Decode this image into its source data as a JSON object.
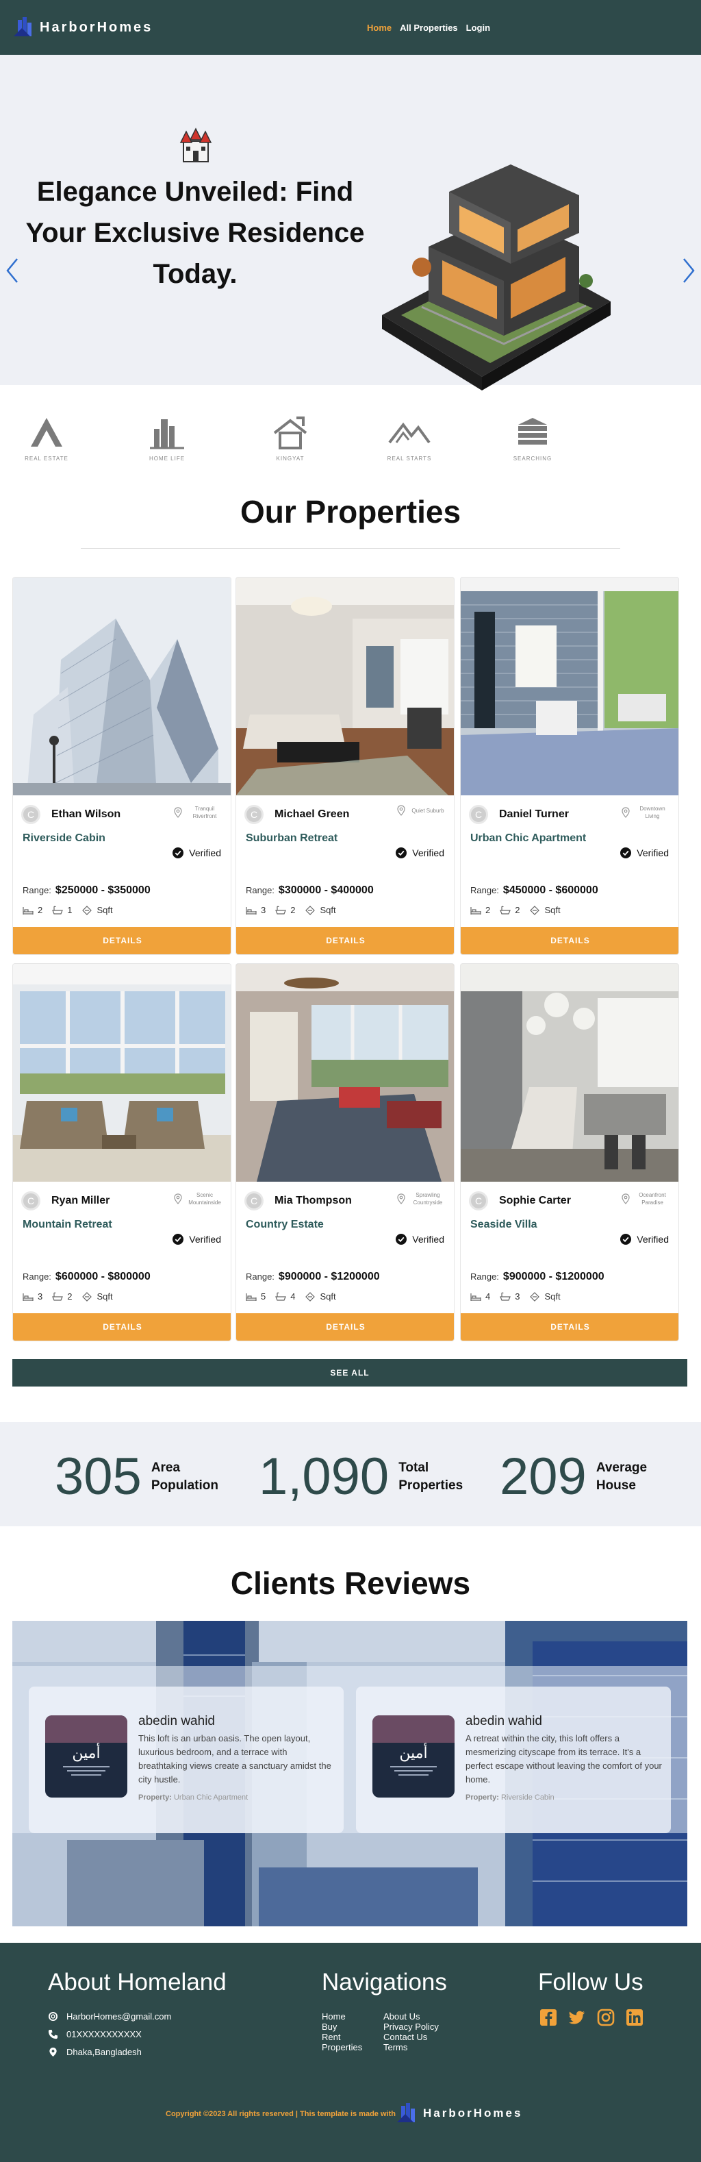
{
  "navbar": {
    "brand": "HarborHomes",
    "links": [
      {
        "label": "Home",
        "active": true
      },
      {
        "label": "All Properties",
        "active": false
      },
      {
        "label": "Login",
        "active": false
      }
    ]
  },
  "hero": {
    "title": "Elegance Unveiled: Find Your Exclusive Residence Today."
  },
  "partners": [
    {
      "label": "REAL ESTATE",
      "icon": "triangle-logo-icon"
    },
    {
      "label": "HOME LIFE",
      "icon": "city-logo-icon"
    },
    {
      "label": "KINGYAT",
      "icon": "house-logo-icon"
    },
    {
      "label": "REAL STARTS",
      "icon": "mountain-logo-icon"
    },
    {
      "label": "SEARCHING",
      "icon": "stack-logo-icon"
    }
  ],
  "properties_section": {
    "title": "Our Properties",
    "range_label": "Range:",
    "details_label": "DETAILS",
    "verified_label": "Verified",
    "sqft_label": "Sqft",
    "see_all_label": "SEE ALL"
  },
  "properties": [
    {
      "agent": "Ethan Wilson",
      "initial": "C",
      "location": "Tranquil Riverfront",
      "title": "Riverside Cabin",
      "range": "$250000 - $350000",
      "beds": "2",
      "baths": "1",
      "photo": "glass-tower"
    },
    {
      "agent": "Michael Green",
      "initial": "C",
      "location": "Quiet Suburb",
      "title": "Suburban Retreat",
      "range": "$300000 - $400000",
      "beds": "3",
      "baths": "2",
      "photo": "living-room"
    },
    {
      "agent": "Daniel Turner",
      "initial": "C",
      "location": "Downtown Living",
      "title": "Urban Chic Apartment",
      "range": "$450000 - $600000",
      "beds": "2",
      "baths": "2",
      "photo": "porch"
    },
    {
      "agent": "Ryan Miller",
      "initial": "C",
      "location": "Scenic Mountainside",
      "title": "Mountain Retreat",
      "range": "$600000 - $800000",
      "beds": "3",
      "baths": "2",
      "photo": "sunroom"
    },
    {
      "agent": "Mia Thompson",
      "initial": "C",
      "location": "Sprawling Countryside",
      "title": "Country Estate",
      "range": "$900000 - $1200000",
      "beds": "5",
      "baths": "4",
      "photo": "bedroom"
    },
    {
      "agent": "Sophie Carter",
      "initial": "C",
      "location": "Oceanfront Paradise",
      "title": "Seaside Villa",
      "range": "$900000 - $1200000",
      "beds": "4",
      "baths": "3",
      "photo": "kitchen"
    }
  ],
  "stats": [
    {
      "value": "305",
      "label_line1": "Area",
      "label_line2": "Population"
    },
    {
      "value": "1,090",
      "label_line1": "Total",
      "label_line2": "Properties"
    },
    {
      "value": "209",
      "label_line1": "Average",
      "label_line2": "House"
    }
  ],
  "reviews_section": {
    "title": "Clients Reviews",
    "property_label": "Property:"
  },
  "reviews": [
    {
      "name": "abedin wahid",
      "text": "This loft is an urban oasis. The open layout, luxurious bedroom, and a terrace with breathtaking views create a sanctuary amidst the city hustle.",
      "property": "Urban Chic Apartment"
    },
    {
      "name": "abedin wahid",
      "text": "A retreat within the city, this loft offers a mesmerizing cityscape from its terrace. It's a perfect escape without leaving the comfort of your home.",
      "property": "Riverside Cabin"
    }
  ],
  "footer": {
    "about_title": "About Homeland",
    "email": "HarborHomes@gmail.com",
    "phone": "01XXXXXXXXXXX",
    "address": "Dhaka,Bangladesh",
    "nav_title": "Navigations",
    "nav_col1": [
      "Home",
      "Buy",
      "Rent",
      "Properties"
    ],
    "nav_col2": [
      "About Us",
      "Privacy Policy",
      "Contact Us",
      "Terms"
    ],
    "follow_title": "Follow Us",
    "social": [
      "facebook-icon",
      "twitter-icon",
      "instagram-icon",
      "linkedin-icon"
    ],
    "copyright": "Copyright ©2023 All rights reserved | This template is made with",
    "brand": "HarborHomes"
  },
  "colors": {
    "primary": "#2e4a4a",
    "accent": "#f0a23a",
    "title_teal": "#2e5b5b",
    "hero_bg": "#eef0f5"
  }
}
